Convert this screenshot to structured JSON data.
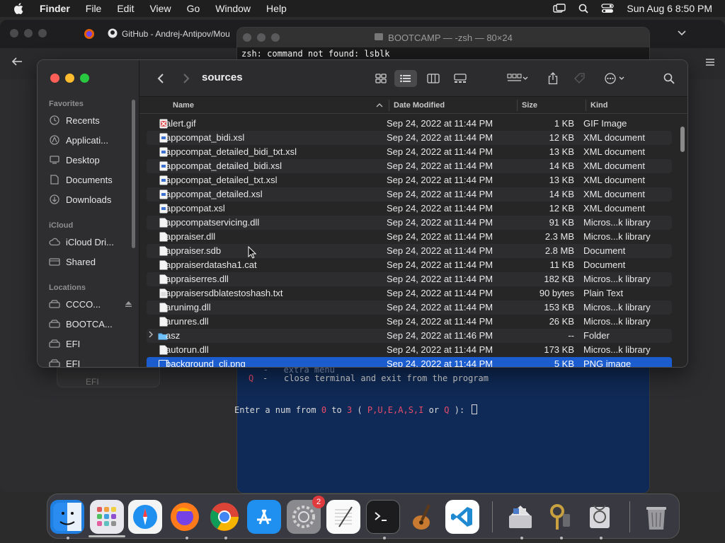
{
  "menubar": {
    "app": "Finder",
    "items": [
      "File",
      "Edit",
      "View",
      "Go",
      "Window",
      "Help"
    ],
    "clock": "Sun Aug 6  8:50 PM"
  },
  "browser": {
    "tab_title": "GitHub - Andrej-Antipov/Mou"
  },
  "terminal": {
    "title": "BOOTCAMP — -zsh — 80×24",
    "first_line": "zsh: command not found: lsblk",
    "partial_line": "   -   extra menu",
    "quit_key": "Q",
    "quit_desc": "close terminal and exit from the program",
    "prompt_prefix": "Enter a num from ",
    "prompt_range_start": "0",
    "prompt_to": " to ",
    "prompt_range_end": "3",
    "prompt_open": " ( ",
    "prompt_keys": "P,U,E,A,S,I",
    "prompt_or": " or ",
    "prompt_q": "Q",
    "prompt_close": " ):"
  },
  "ghost_label": "EFI",
  "finder": {
    "folder_title": "sources",
    "sidebar": {
      "favorites_label": "Favorites",
      "favorites": [
        "Recents",
        "Applicati...",
        "Desktop",
        "Documents",
        "Downloads"
      ],
      "icloud_label": "iCloud",
      "icloud": [
        "iCloud Dri...",
        "Shared"
      ],
      "locations_label": "Locations",
      "locations": [
        "CCCO...",
        "BOOTCA...",
        "EFI",
        "EFI"
      ]
    },
    "columns": {
      "name": "Name",
      "date": "Date Modified",
      "size": "Size",
      "kind": "Kind"
    },
    "files": [
      {
        "name": "alert.gif",
        "date": "Sep 24, 2022 at 11:44 PM",
        "size": "1 KB",
        "kind": "GIF Image",
        "icon": "gif-file-icon"
      },
      {
        "name": "appcompat_bidi.xsl",
        "date": "Sep 24, 2022 at 11:44 PM",
        "size": "12 KB",
        "kind": "XML document",
        "icon": "xml-file-icon"
      },
      {
        "name": "appcompat_detailed_bidi_txt.xsl",
        "date": "Sep 24, 2022 at 11:44 PM",
        "size": "13 KB",
        "kind": "XML document",
        "icon": "xml-file-icon"
      },
      {
        "name": "appcompat_detailed_bidi.xsl",
        "date": "Sep 24, 2022 at 11:44 PM",
        "size": "14 KB",
        "kind": "XML document",
        "icon": "xml-file-icon"
      },
      {
        "name": "appcompat_detailed_txt.xsl",
        "date": "Sep 24, 2022 at 11:44 PM",
        "size": "13 KB",
        "kind": "XML document",
        "icon": "xml-file-icon"
      },
      {
        "name": "appcompat_detailed.xsl",
        "date": "Sep 24, 2022 at 11:44 PM",
        "size": "14 KB",
        "kind": "XML document",
        "icon": "xml-file-icon"
      },
      {
        "name": "appcompat.xsl",
        "date": "Sep 24, 2022 at 11:44 PM",
        "size": "12 KB",
        "kind": "XML document",
        "icon": "xml-file-icon"
      },
      {
        "name": "appcompatservicing.dll",
        "date": "Sep 24, 2022 at 11:44 PM",
        "size": "91 KB",
        "kind": "Micros...k library",
        "icon": "document-icon"
      },
      {
        "name": "appraiser.dll",
        "date": "Sep 24, 2022 at 11:44 PM",
        "size": "2.3 MB",
        "kind": "Micros...k library",
        "icon": "document-icon"
      },
      {
        "name": "appraiser.sdb",
        "date": "Sep 24, 2022 at 11:44 PM",
        "size": "2.8 MB",
        "kind": "Document",
        "icon": "document-icon"
      },
      {
        "name": "appraiserdatasha1.cat",
        "date": "Sep 24, 2022 at 11:44 PM",
        "size": "11 KB",
        "kind": "Document",
        "icon": "document-icon"
      },
      {
        "name": "appraiserres.dll",
        "date": "Sep 24, 2022 at 11:44 PM",
        "size": "182 KB",
        "kind": "Micros...k library",
        "icon": "document-icon"
      },
      {
        "name": "appraisersdblatestoshash.txt",
        "date": "Sep 24, 2022 at 11:44 PM",
        "size": "90 bytes",
        "kind": "Plain Text",
        "icon": "text-file-icon"
      },
      {
        "name": "arunimg.dll",
        "date": "Sep 24, 2022 at 11:44 PM",
        "size": "153 KB",
        "kind": "Micros...k library",
        "icon": "document-icon"
      },
      {
        "name": "arunres.dll",
        "date": "Sep 24, 2022 at 11:44 PM",
        "size": "26 KB",
        "kind": "Micros...k library",
        "icon": "document-icon"
      },
      {
        "name": "asz",
        "date": "Sep 24, 2022 at 11:46 PM",
        "size": "--",
        "kind": "Folder",
        "icon": "folder-icon"
      },
      {
        "name": "autorun.dll",
        "date": "Sep 24, 2022 at 11:44 PM",
        "size": "173 KB",
        "kind": "Micros...k library",
        "icon": "document-icon"
      },
      {
        "name": "background_cli.png",
        "date": "Sep 24, 2022 at 11:44 PM",
        "size": "5 KB",
        "kind": "PNG image",
        "icon": "image-file-icon",
        "selected": true
      }
    ]
  },
  "dock": {
    "badge_count": "2",
    "apps": [
      "finder-icon",
      "launchpad-icon",
      "safari-icon",
      "firefox-icon",
      "chrome-icon",
      "app-store-icon",
      "system-settings-icon",
      "textedit-icon",
      "terminal-icon",
      "garageband-icon",
      "vscode-icon",
      "boot-camp-assistant-icon",
      "keychain-access-icon",
      "disk-utility-icon",
      "trash-icon"
    ]
  },
  "colors": {
    "selection": "#1b5ccf",
    "terminal_bg": "#0f2a56",
    "accent_red": "#ff5f57",
    "accent_yellow": "#febc2e",
    "accent_green": "#28c840"
  }
}
